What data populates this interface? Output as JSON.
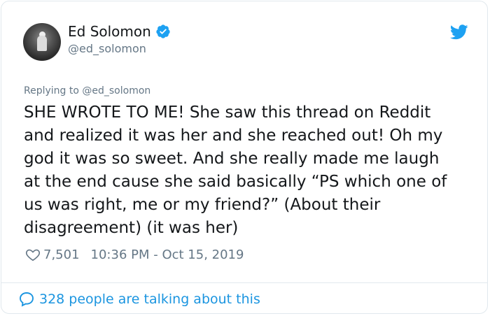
{
  "author": {
    "name": "Ed Solomon",
    "handle": "@ed_solomon",
    "verified_icon": "verified-badge-icon",
    "avatar_icon": "avatar-photo"
  },
  "platform_icon": "twitter-bird-icon",
  "reply": {
    "prefix": "Replying to ",
    "mention": "@ed_solomon"
  },
  "tweet": {
    "text": "SHE WROTE TO ME! She saw this thread on Reddit\nand realized it was her and she reached out! Oh my\ngod it was so sweet. And she really made me laugh\nat the end cause she said basically “PS which one of\nus was right, me or my friend?” (About their\ndisagreement) (it was her)"
  },
  "meta": {
    "likes": "7,501",
    "timestamp": "10:36 PM - Oct 15, 2019"
  },
  "footer": {
    "talking": "328 people are talking about this"
  },
  "colors": {
    "accent": "#1da1f2",
    "link": "#1b95e0",
    "muted": "#657786",
    "text": "#14171a"
  }
}
